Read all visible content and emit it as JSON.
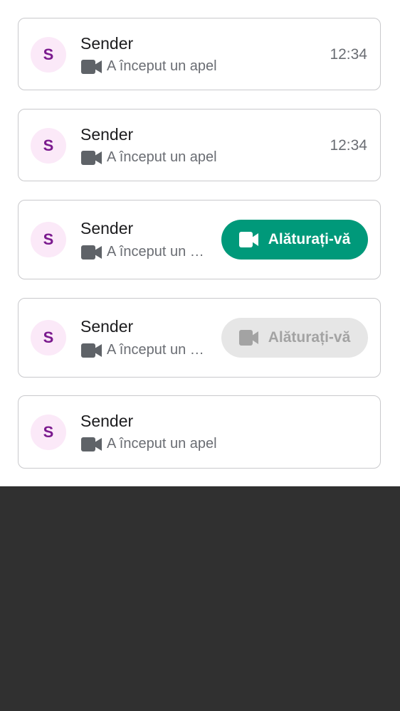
{
  "messages": [
    {
      "avatar_letter": "S",
      "sender": "Sender",
      "subtitle": "A început un apel",
      "time": "12:34"
    },
    {
      "avatar_letter": "S",
      "sender": "Sender",
      "subtitle": "A început un apel",
      "time": "12:34"
    },
    {
      "avatar_letter": "S",
      "sender": "Sender",
      "subtitle": "A început un apel",
      "join_label": "Alăturați-vă",
      "join_state": "enabled"
    },
    {
      "avatar_letter": "S",
      "sender": "Sender",
      "subtitle": "A început un apel",
      "join_label": "Alăturați-vă",
      "join_state": "disabled"
    },
    {
      "avatar_letter": "S",
      "sender": "Sender",
      "subtitle": "A început un apel"
    }
  ],
  "colors": {
    "avatar_bg": "#fbe9f8",
    "avatar_text": "#7b1a8e",
    "join_active": "#00997a",
    "join_disabled": "#e6e6e6",
    "card_border": "#c9c9cc",
    "bottom_area": "#303030"
  },
  "icons": {
    "call_icon": "video-camera-icon"
  }
}
